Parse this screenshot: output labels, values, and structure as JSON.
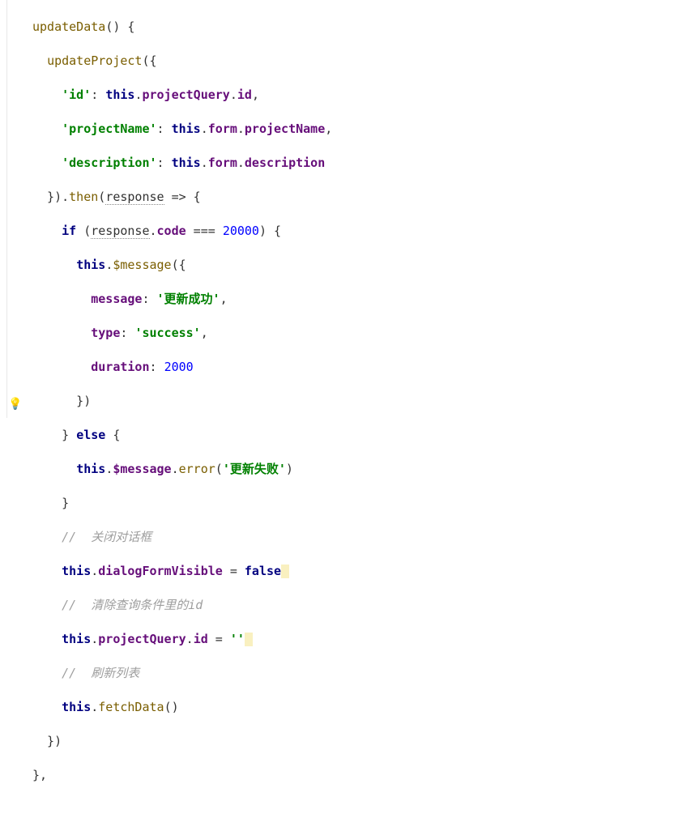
{
  "code": {
    "l1_fn": "updateData",
    "l2_fn": "updateProject",
    "l3_key": "'id'",
    "l3_this": "this",
    "l3_prop": "projectQuery",
    "l3_field": "id",
    "l4_key": "'projectName'",
    "l4_this": "this",
    "l4_prop": "form",
    "l4_field": "projectName",
    "l5_key": "'description'",
    "l5_this": "this",
    "l5_prop": "form",
    "l5_field": "description",
    "l6_then": "then",
    "l6_arg": "response",
    "l7_if": "if",
    "l7_resp": "response",
    "l7_code": "code",
    "l7_val": "20000",
    "l8_this": "this",
    "l8_msg": "$message",
    "l9_key": "message",
    "l9_val": "'更新成功'",
    "l10_key": "type",
    "l10_val": "'success'",
    "l11_key": "duration",
    "l11_val": "2000",
    "l13_else": "else",
    "l14_this": "this",
    "l14_msg": "$message",
    "l14_err": "error",
    "l14_txt": "'更新失败'",
    "c1": "//  关闭对话框",
    "l17_this": "this",
    "l17_prop": "dialogFormVisible",
    "l17_val": "false",
    "c2": "//  清除查询条件里的id",
    "l19_this": "this",
    "l19_prop": "projectQuery",
    "l19_field": "id",
    "l19_val": "''",
    "c3": "//  刷新列表",
    "l21_this": "this",
    "l21_fn": "fetchData"
  }
}
